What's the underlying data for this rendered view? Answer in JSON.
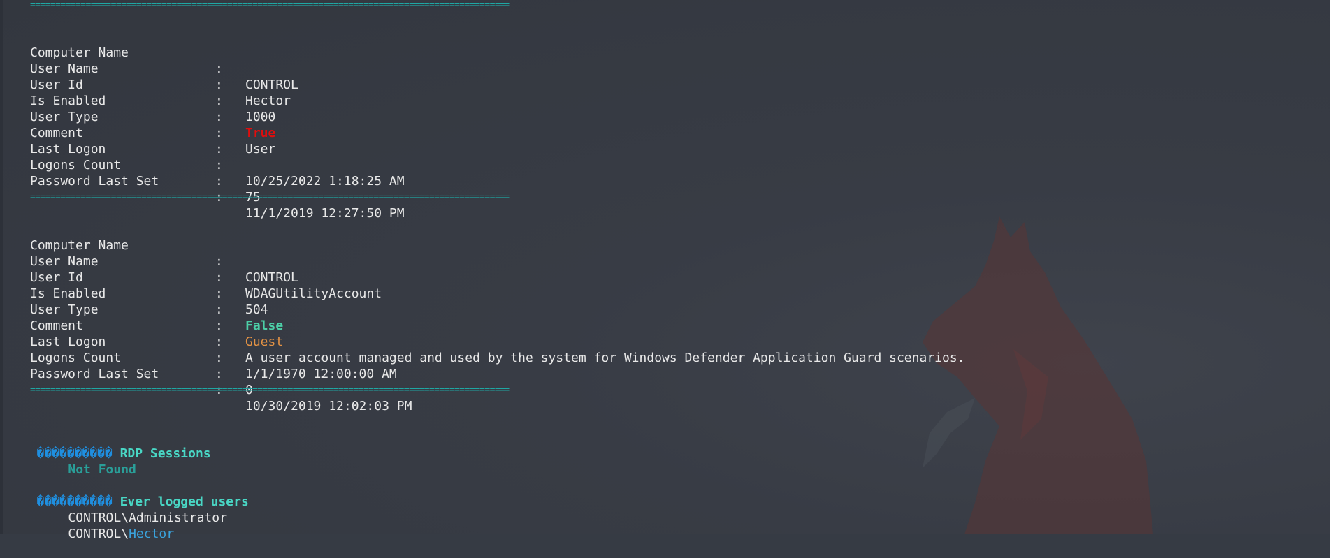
{
  "colors": {
    "background": "#363b44",
    "separator": "#1fa7a3",
    "true_red": "#e00d0d",
    "false_green": "#4ccfa7",
    "guest_orange": "#e39244",
    "section_title": "#49d6c4",
    "not_found": "#2a9e98",
    "user_blue": "#3aa2dc"
  },
  "separator": "===============================================================================================",
  "user_blocks": [
    {
      "rows": [
        {
          "key": "Computer Name",
          "colon": ":",
          "value": "CONTROL"
        },
        {
          "key": "User Name",
          "colon": ":",
          "value": "Hector"
        },
        {
          "key": "User Id",
          "colon": ":",
          "value": "1000"
        },
        {
          "key": "Is Enabled",
          "colon": ":",
          "value": "True"
        },
        {
          "key": "User Type",
          "colon": ":",
          "value": "User"
        },
        {
          "key": "Comment",
          "colon": ":",
          "value": ""
        },
        {
          "key": "Last Logon",
          "colon": ":",
          "value": "10/25/2022 1:18:25 AM"
        },
        {
          "key": "Logons Count",
          "colon": ":",
          "value": "75"
        },
        {
          "key": "Password Last Set",
          "colon": ":",
          "value": "11/1/2019 12:27:50 PM"
        }
      ]
    },
    {
      "rows": [
        {
          "key": "Computer Name",
          "colon": ":",
          "value": "CONTROL"
        },
        {
          "key": "User Name",
          "colon": ":",
          "value": "WDAGUtilityAccount"
        },
        {
          "key": "User Id",
          "colon": ":",
          "value": "504"
        },
        {
          "key": "Is Enabled",
          "colon": ":",
          "value": "False"
        },
        {
          "key": "User Type",
          "colon": ":",
          "value": "Guest"
        },
        {
          "key": "Comment",
          "colon": ":",
          "value": "A user account managed and used by the system for Windows Defender Application Guard scenarios."
        },
        {
          "key": "Last Logon",
          "colon": ":",
          "value": "1/1/1970 12:00:00 AM"
        },
        {
          "key": "Logons Count",
          "colon": ":",
          "value": "0"
        },
        {
          "key": "Password Last Set",
          "colon": ":",
          "value": "10/30/2019 12:02:03 PM"
        }
      ]
    }
  ],
  "sections": {
    "rdp": {
      "bullet": "����������",
      "title": "RDP Sessions",
      "result": "Not Found"
    },
    "ever_logged": {
      "bullet": "����������",
      "title": "Ever logged users",
      "users": [
        {
          "prefix": "CONTROL\\",
          "name": "Administrator"
        },
        {
          "prefix": "CONTROL\\",
          "name": "Hector"
        }
      ]
    }
  }
}
